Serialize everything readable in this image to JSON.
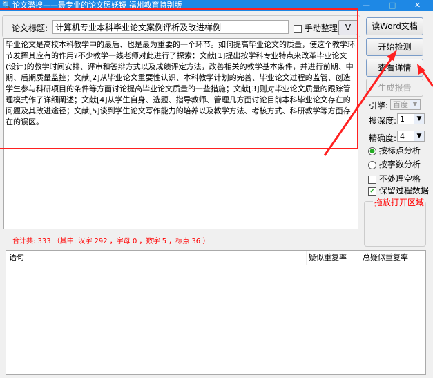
{
  "window": {
    "title": "论文潜搜——最专业的论文照妖镜 福州教育特别版",
    "minimize": "—",
    "maximize": "□",
    "close": "✕"
  },
  "title_row": {
    "label": "论文标题:",
    "value": "计算机专业本科毕业论文案例评析及改进样例",
    "manual_label": "手动整理",
    "manual_checked": false,
    "v_button": "V"
  },
  "content": "毕业论文是高校本科教学中的最后、也是最为重要的一个环节。如何提高毕业论文的质量，使这个教学环节发挥其应有的作用?不少教学一线老师对此进行了探索：文献[1]提出按学科专业特点来改革毕业论文(设计)的教学时间安排、评审和答辩方式以及成绩评定方法，改善相关的教学基本条件，并进行前期、中期、后期质量监控；文献[2]从毕业论文重要性认识、本科教学计划的完善、毕业论文过程的监管、创造学生参与科研项目的条件等方面讨论提高毕业论文质量的一些措施；文献[3]则对毕业论文质量的跟踪管理模式作了详细阐述；文献[4]从学生自身、选题、指导教师、管理几方面讨论目前本科毕业论文存在的问题及其改进途径；文献[5]谈到学生论文写作能力的培养以及教学方法、考核方式、科研教学等方面存在的误区。",
  "buttons": {
    "read_word": "读Word文档",
    "start": "开始检测",
    "details": "查看详情",
    "report": "生成报告"
  },
  "options": {
    "engine_label": "引擎:",
    "engine_value": "百度",
    "depth_label": "搜深度:",
    "depth_value": "1",
    "precision_label": "精确度:",
    "precision_value": "4",
    "radio_punct": "按标点分析",
    "radio_count": "按字数分析",
    "radio_selected": "punct",
    "skip_space": "不处理空格",
    "skip_space_checked": false,
    "keep_data": "保留过程数据",
    "keep_data_checked": true,
    "drop_area": "拖放打开区域"
  },
  "stats": "合计共: 333 （其中: 汉字 292 ，字母 0 ，数字 5 ，标点 36 ）",
  "table": {
    "columns": [
      "语句",
      "疑似重复率",
      "总疑似重复率"
    ],
    "rows": []
  },
  "colors": {
    "titlebar": "#1e88e5",
    "annotation": "#ff2020",
    "stats": "#ff0000"
  }
}
